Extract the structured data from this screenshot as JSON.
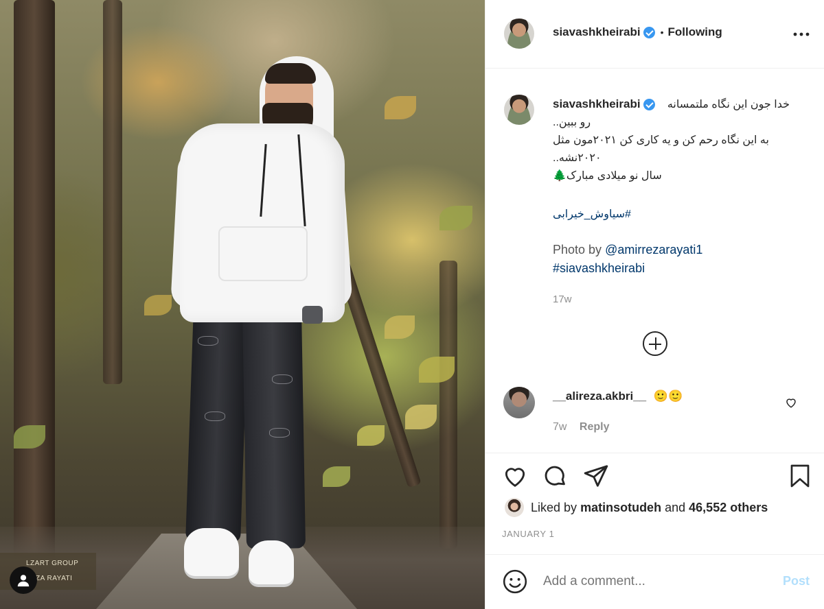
{
  "photo": {
    "watermark_line1": "LZART GROUP",
    "watermark_line2": "ZA RAYATI"
  },
  "header": {
    "username": "siavashkheirabi",
    "separator": "•",
    "follow_status": "Following",
    "more_icon": "more-horizontal-icon"
  },
  "caption": {
    "username": "siavashkheirabi",
    "lines": [
      "خدا جون این نگاه ملتمسانه",
      "رو ببین..",
      "به این نگاه رحم کن و یه کاری کن ۲۰۲۱مون مثل",
      "۲۰۲۰نشه..",
      "سال نو میلادی مبارک🌲"
    ],
    "hashtag_fa": "#سیاوش_خیرابی",
    "photo_by_label": "Photo by",
    "photo_by_mention": "@amirrezarayati1",
    "hashtag_en": "#siavashkheirabi",
    "time": "17w"
  },
  "load_more_icon": "plus-circle-icon",
  "comment": {
    "username": "__alireza.akbri__",
    "text": "🙂🙂",
    "time": "7w",
    "reply_label": "Reply"
  },
  "actions": {
    "like_icon": "heart-icon",
    "comment_icon": "comment-icon",
    "share_icon": "send-icon",
    "save_icon": "bookmark-icon"
  },
  "likes": {
    "prefix": "Liked by",
    "liker": "matinsotudeh",
    "and_label": "and",
    "others": "46,552 others"
  },
  "date": "JANUARY 1",
  "add_comment": {
    "placeholder": "Add a comment...",
    "post_label": "Post",
    "emoji_icon": "emoji-smile-icon"
  },
  "colors": {
    "verified": "#3897f0",
    "link": "#00376b",
    "post_disabled": "#b2dffc",
    "muted": "#8e8e8e"
  }
}
